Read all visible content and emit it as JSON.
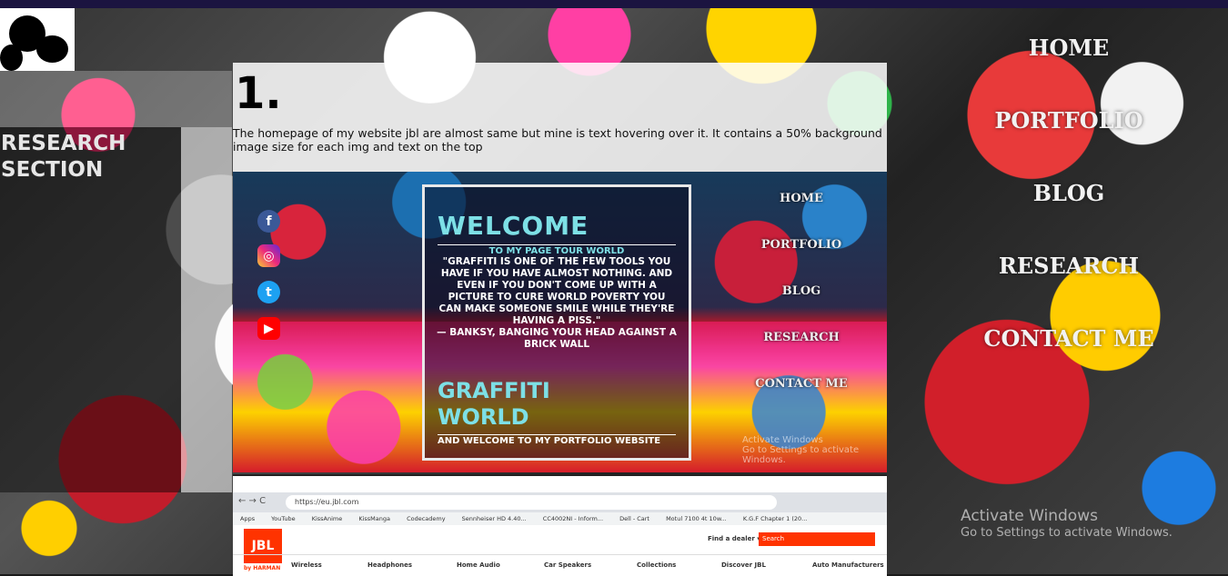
{
  "left": {
    "section_title": "RESEARCH SECTION"
  },
  "card": {
    "number": "1.",
    "description": "The homepage of my website jbl are almost same but mine is text hovering over it. It contains a 50% background image size for each img and text on the top"
  },
  "preview1": {
    "social": [
      "f",
      "◎",
      "t",
      "▶"
    ],
    "welcome": "WELCOME",
    "welcome_sub": "TO MY PAGE TOUR WORLD",
    "quote": "\"GRAFFITI IS ONE OF THE FEW TOOLS YOU HAVE IF YOU HAVE ALMOST NOTHING. AND EVEN IF YOU DON'T COME UP WITH A PICTURE TO CURE WORLD POVERTY YOU CAN MAKE SOMEONE SMILE WHILE THEY'RE HAVING A PISS.\"",
    "attribution": "— BANKSY, BANGING YOUR HEAD AGAINST A BRICK WALL",
    "graffiti_title": "GRAFFITI WORLD",
    "graffiti_sub": "AND WELCOME TO MY PORTFOLIO WEBSITE",
    "nav": [
      "HOME",
      "PORTFOLIO",
      "BLOG",
      "RESEARCH",
      "CONTACT ME"
    ],
    "activate_line1": "Activate Windows",
    "activate_line2": "Go to Settings to activate Windows."
  },
  "preview2": {
    "nav_buttons": "← → C",
    "url": "https://eu.jbl.com",
    "bookmarks": [
      "Apps",
      "YouTube",
      "KissAnime",
      "KissManga",
      "Codecademy",
      "Sennheiser HD 4.40...",
      "CC4002NI - Inform...",
      "Dell - Cart",
      "Motul 7100 4t 10w...",
      "K.G.F Chapter 1 (20..."
    ],
    "logo": "JBL",
    "harman": "by HARMAN",
    "find_dealer": "Find a dealer ▾",
    "search": "Search",
    "nav": [
      "Wireless",
      "Headphones",
      "Home Audio",
      "Car Speakers",
      "Collections",
      "Discover JBL",
      "Auto Manufacturers"
    ]
  },
  "right_nav": [
    "HOME",
    "PORTFOLIO",
    "BLOG",
    "RESEARCH",
    "CONTACT ME"
  ],
  "activate": {
    "line1": "Activate Windows",
    "line2": "Go to Settings to activate Windows."
  }
}
